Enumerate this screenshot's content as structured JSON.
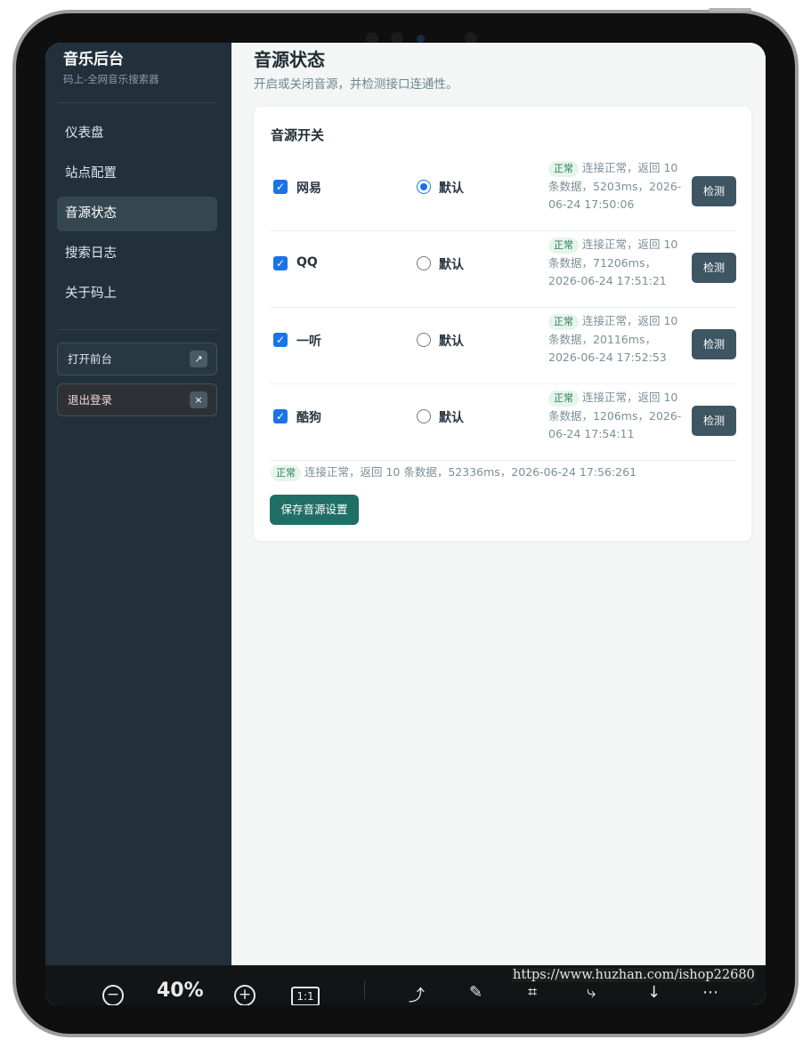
{
  "sidebar": {
    "brand_title": "音乐后台",
    "brand_subtitle": "码上-全网音乐搜索器",
    "items": [
      {
        "label": "仪表盘"
      },
      {
        "label": "站点配置"
      },
      {
        "label": "音源状态"
      },
      {
        "label": "搜索日志"
      },
      {
        "label": "关于码上"
      }
    ],
    "active_index": 2,
    "open_frontend": {
      "label": "打开前台",
      "icon": "↗"
    },
    "logout": {
      "label": "退出登录",
      "icon": "×"
    }
  },
  "main": {
    "title": "音源状态",
    "description": "开启或关闭音源，并检测接口连通性。",
    "card_title": "音源开关",
    "sources": [
      {
        "name": "网易",
        "enabled": true,
        "default_label": "默认",
        "is_default": true,
        "badge": "正常",
        "status_text": "连接正常，返回 10 条数据，5203ms，2026-06-24 17:50:06",
        "check_label": "检测"
      },
      {
        "name": "QQ",
        "enabled": true,
        "default_label": "默认",
        "is_default": false,
        "badge": "正常",
        "status_text": "连接正常，返回 10 条数据，71206ms，2026-06-24 17:51:21",
        "check_label": "检测"
      },
      {
        "name": "一听",
        "enabled": true,
        "default_label": "默认",
        "is_default": false,
        "badge": "正常",
        "status_text": "连接正常，返回 10 条数据，20116ms，2026-06-24 17:52:53",
        "check_label": "检测"
      },
      {
        "name": "酷狗",
        "enabled": true,
        "default_label": "默认",
        "is_default": false,
        "badge": "正常",
        "status_text": "连接正常，返回 10 条数据，1206ms，2026-06-24 17:54:11",
        "check_label": "检测"
      }
    ],
    "summary_badge": "正常",
    "summary_text": "连接正常，返回 10 条数据，52336ms，2026-06-24 17:56:261",
    "save_label": "保存音源设置"
  },
  "toolbar": {
    "zoom_out_icon": "minus-circle-icon",
    "zoom_level": "40%",
    "zoom_in_icon": "plus-circle-icon",
    "actual_size_label": "1:1",
    "tools": [
      "rotate-icon",
      "pen-icon",
      "text-recognition-icon",
      "share-icon",
      "download-icon",
      "more-icon"
    ]
  },
  "watermark": "https://www.huzhan.com/ishop22680",
  "colors": {
    "sidebar_bg": "#21303a",
    "accent_save": "#1f6f66",
    "check_button": "#3e5562",
    "checkbox_blue": "#1a73e8",
    "badge_bg": "#e5f5ec",
    "badge_text": "#2e7d55"
  }
}
